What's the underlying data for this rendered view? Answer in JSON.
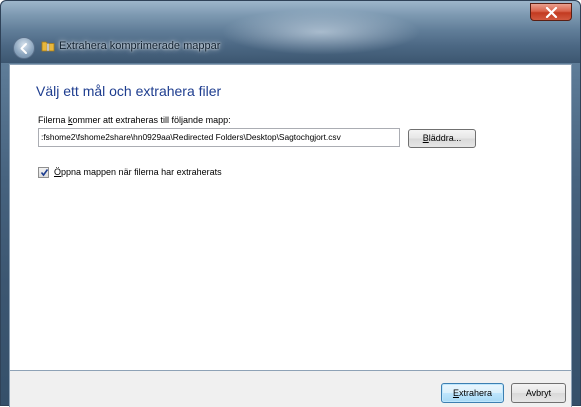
{
  "window": {
    "title": "Extrahera komprimerade mappar"
  },
  "main": {
    "heading": "Välj ett mål och extrahera filer",
    "path_label": "Filerna kommer att extraheras till följande mapp:",
    "path_value": ":fshome2\\fshome2share\\hn0929aa\\Redirected Folders\\Desktop\\Sagtochgjort.csv",
    "browse_label": "Bläddra...",
    "open_folder_checkbox": {
      "label": "Öppna mappen när filerna har extraherats",
      "checked": true
    }
  },
  "footer": {
    "extract_label": "Extrahera",
    "cancel_label": "Avbryt"
  },
  "colors": {
    "heading": "#1e3d8f",
    "close_button": "#c23a20",
    "default_button_border": "#3c7fb1"
  },
  "icons": {
    "back": "back-arrow-icon",
    "folder": "zip-folder-icon",
    "close": "close-icon",
    "check": "checkmark-icon"
  }
}
